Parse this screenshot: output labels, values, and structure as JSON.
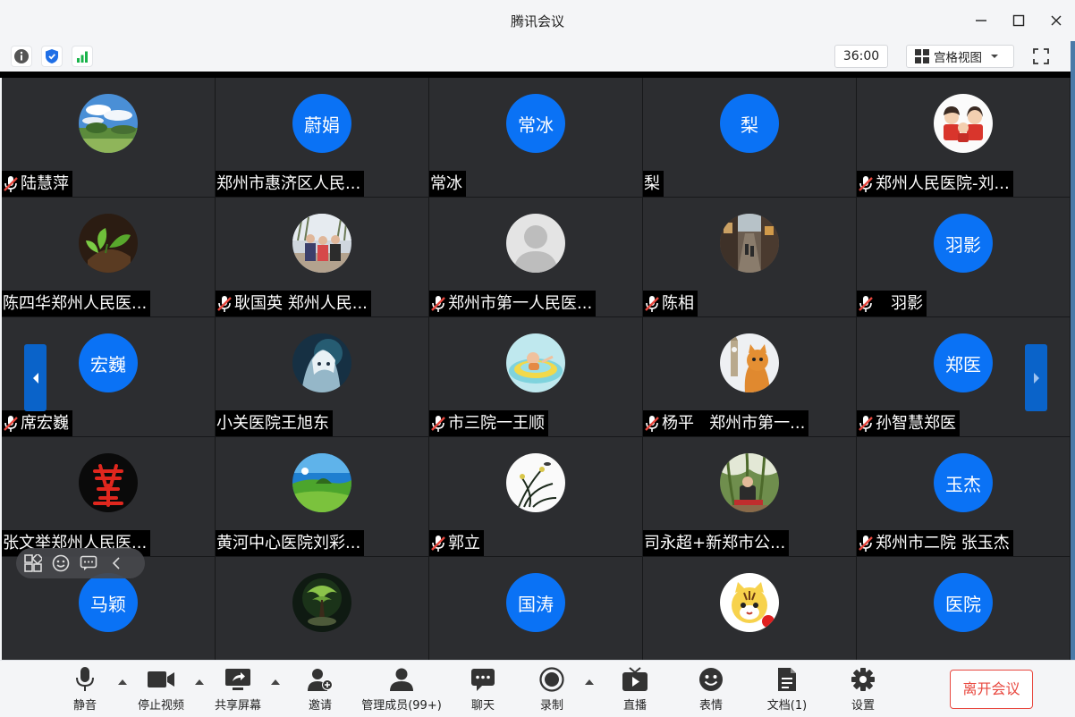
{
  "window": {
    "title": "腾讯会议"
  },
  "infobar": {
    "timer": "36:00",
    "view_mode": "宫格视图"
  },
  "colors": {
    "accent": "#0a72f5",
    "leave": "#e8483f",
    "tile_bg": "#2c2d30"
  },
  "tiles": [
    {
      "avatar_type": "photo-sky",
      "name": "陆慧萍",
      "muted": true
    },
    {
      "avatar_type": "text",
      "avatar_text": "蔚娟",
      "name": "郑州市惠济区人民...",
      "muted": false
    },
    {
      "avatar_type": "text",
      "avatar_text": "常冰",
      "name": "常冰",
      "muted": false
    },
    {
      "avatar_type": "text",
      "avatar_text": "梨",
      "name": "梨",
      "muted": false
    },
    {
      "avatar_type": "photo-family",
      "name": "郑州人民医院-刘...",
      "muted": true
    },
    {
      "avatar_type": "photo-plant",
      "name": "陈四华郑州人民医...",
      "muted": false
    },
    {
      "avatar_type": "photo-people",
      "name": "耿国英 郑州人民...",
      "muted": true
    },
    {
      "avatar_type": "photo-default",
      "name": "郑州市第一人民医...",
      "muted": true
    },
    {
      "avatar_type": "photo-street",
      "name": "陈相",
      "muted": true
    },
    {
      "avatar_type": "text",
      "avatar_text": "羽影",
      "name": "   羽影",
      "muted": true
    },
    {
      "avatar_type": "text",
      "avatar_text": "宏巍",
      "name": "席宏巍",
      "muted": true
    },
    {
      "avatar_type": "photo-anime",
      "name": "小关医院王旭东",
      "muted": false
    },
    {
      "avatar_type": "photo-baby",
      "name": "市三院一王顺",
      "muted": true
    },
    {
      "avatar_type": "photo-cat",
      "name": "杨平   郑州市第一...",
      "muted": true
    },
    {
      "avatar_type": "text",
      "avatar_text": "郑医",
      "name": "孙智慧郑医",
      "muted": true
    },
    {
      "avatar_type": "photo-seal",
      "name": "张文举郑州人民医...",
      "muted": false
    },
    {
      "avatar_type": "photo-landscape",
      "name": "黄河中心医院刘彩...",
      "muted": false
    },
    {
      "avatar_type": "photo-orchid",
      "name": "郭立",
      "muted": true
    },
    {
      "avatar_type": "photo-park",
      "name": "司永超+新郑市公...",
      "muted": false
    },
    {
      "avatar_type": "text",
      "avatar_text": "玉杰",
      "name": "郑州市二院 张玉杰",
      "muted": true
    },
    {
      "avatar_type": "text",
      "avatar_text": "马颖",
      "name": "",
      "muted": false
    },
    {
      "avatar_type": "photo-tree",
      "name": "",
      "muted": false
    },
    {
      "avatar_type": "text",
      "avatar_text": "国涛",
      "name": "",
      "muted": false
    },
    {
      "avatar_type": "photo-tiger",
      "name": "",
      "muted": false
    },
    {
      "avatar_type": "text",
      "avatar_text": "医院",
      "name": "",
      "muted": false
    }
  ],
  "toolbar": {
    "mute": "静音",
    "stop_video": "停止视频",
    "share_screen": "共享屏幕",
    "invite": "邀请",
    "manage_members": "管理成员(99+)",
    "chat": "聊天",
    "record": "录制",
    "live": "直播",
    "reaction": "表情",
    "docs": "文档(1)",
    "settings": "设置",
    "leave": "离开会议"
  }
}
